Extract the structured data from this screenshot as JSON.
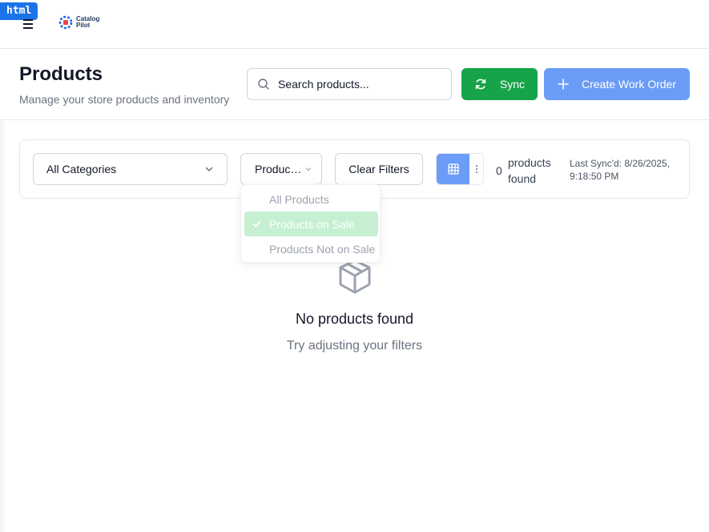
{
  "badge": "html",
  "logo": {
    "line1": "Catalog",
    "line2": "Pilot"
  },
  "header": {
    "title": "Products",
    "subtitle": "Manage your store products and inventory",
    "search_placeholder": "Search products...",
    "sync_label": "Sync",
    "create_label": "Create Work Order"
  },
  "filters": {
    "category_value": "All Categories",
    "product_value": "Products on Sale",
    "clear_label": "Clear Filters",
    "count": "0",
    "count_label": "products found",
    "last_sync": "Last Sync'd: 8/26/2025, 9:18:50 PM"
  },
  "dropdown": {
    "options": [
      "All Products",
      "Products on Sale",
      "Products Not on Sale"
    ],
    "selected": "Products on Sale"
  },
  "empty": {
    "title": "No products found",
    "subtitle": "Try adjusting your filters"
  },
  "colors": {
    "primary_green": "#16a34a",
    "primary_blue": "#6b9cf7",
    "selected_option": "#c6f0d1"
  }
}
